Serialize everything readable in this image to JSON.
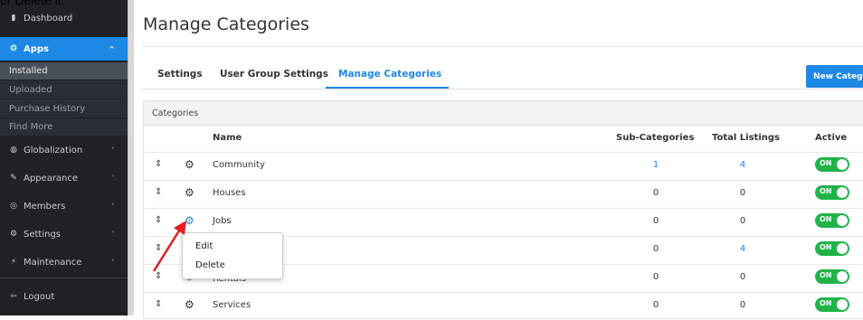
{
  "caption": "or Delete it.",
  "sidebar": {
    "items": [
      {
        "icon": "chart-icon",
        "glyph": "▮",
        "label": "Dashboard",
        "chev": ""
      },
      {
        "icon": "apps-icon",
        "glyph": "❂",
        "label": "Apps",
        "chev": "^"
      },
      {
        "label": "Installed"
      },
      {
        "label": "Uploaded"
      },
      {
        "label": "Purchase History"
      },
      {
        "label": "Find More"
      },
      {
        "icon": "globe-icon",
        "glyph": "◍",
        "label": "Globalization",
        "chev": "˅"
      },
      {
        "icon": "brush-icon",
        "glyph": "✎",
        "label": "Appearance",
        "chev": "˅"
      },
      {
        "icon": "members-icon",
        "glyph": "◎",
        "label": "Members",
        "chev": "˅"
      },
      {
        "icon": "gear-icon",
        "glyph": "⚙",
        "label": "Settings",
        "chev": "˅"
      },
      {
        "icon": "bolt-icon",
        "glyph": "⚡",
        "label": "Maintenance",
        "chev": "˅"
      },
      {
        "icon": "logout-icon",
        "glyph": "⇦",
        "label": "Logout",
        "chev": ""
      }
    ]
  },
  "page": {
    "title": "Manage Categories"
  },
  "tabs": [
    "Settings",
    "User Group Settings",
    "Manage Categories"
  ],
  "new_button": "New Category",
  "panel": {
    "heading": "Categories",
    "columns": {
      "name": "Name",
      "sub": "Sub-Categories",
      "total": "Total Listings",
      "active": "Active"
    },
    "toggle_label": "ON",
    "rows": [
      {
        "name": "Community",
        "sub": "1",
        "total": "4",
        "sub_link": true,
        "total_link": true
      },
      {
        "name": "Houses",
        "sub": "0",
        "total": "0",
        "sub_link": false,
        "total_link": false
      },
      {
        "name": "Jobs",
        "sub": "0",
        "total": "0",
        "sub_link": false,
        "total_link": false
      },
      {
        "name": "",
        "sub": "0",
        "total": "4",
        "sub_link": false,
        "total_link": true
      },
      {
        "name": "Rentals",
        "sub": "0",
        "total": "0",
        "sub_link": false,
        "total_link": false
      },
      {
        "name": "Services",
        "sub": "0",
        "total": "0",
        "sub_link": false,
        "total_link": false
      }
    ]
  },
  "context_menu": {
    "edit": "Edit",
    "delete": "Delete"
  },
  "colors": {
    "accent": "#1e88e5",
    "toggle_on": "#21b34a",
    "sidebar": "#1f2328",
    "arrow": "#e02020"
  }
}
